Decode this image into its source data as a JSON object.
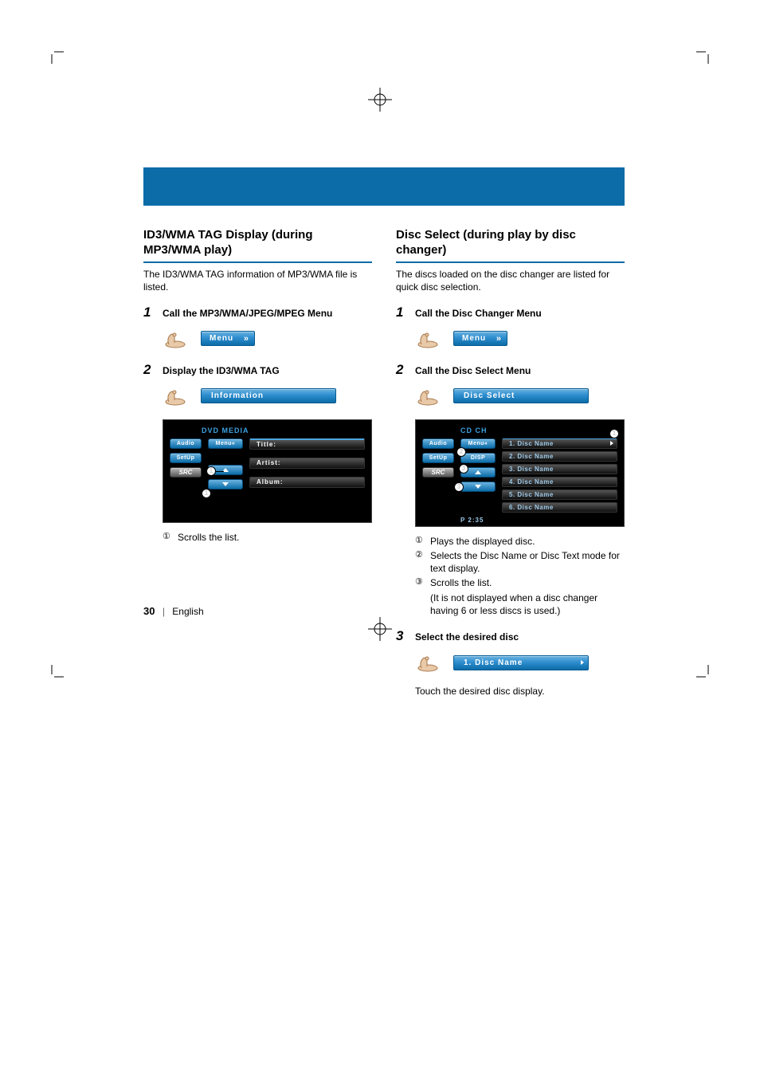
{
  "left": {
    "title": "ID3/WMA TAG Display (during MP3/WMA play)",
    "desc": "The ID3/WMA TAG information of MP3/WMA file is listed.",
    "step1": {
      "num": "1",
      "title": "Call the MP3/WMA/JPEG/MPEG Menu"
    },
    "menu_btn": "Menu",
    "step2": {
      "num": "2",
      "title": "Display the ID3/WMA TAG"
    },
    "info_btn": "Information",
    "panel": {
      "header": "DVD MEDIA",
      "side": {
        "audio": "Audio",
        "setup": "SetUp",
        "src": "SRC",
        "menu": "Menu«"
      },
      "rows": {
        "title": "Title:",
        "artist": "Artist:",
        "album": "Album:"
      }
    },
    "notes": {
      "n1": {
        "num": "1",
        "text": "Scrolls the list."
      }
    }
  },
  "right": {
    "title": "Disc Select (during play by disc changer)",
    "desc": "The discs loaded on the disc changer are listed for quick disc selection.",
    "step1": {
      "num": "1",
      "title": "Call the Disc Changer Menu"
    },
    "menu_btn": "Menu",
    "step2": {
      "num": "2",
      "title": "Call the Disc Select Menu"
    },
    "discselect_btn": "Disc Select",
    "panel": {
      "header": "CD CH",
      "side": {
        "audio": "Audio",
        "setup": "SetUp",
        "src": "SRC",
        "menu": "Menu«",
        "disp": "DISP"
      },
      "rows": {
        "d1": "1. Disc Name",
        "d2": "2. Disc Name",
        "d3": "3. Disc Name",
        "d4": "4. Disc Name",
        "d5": "5. Disc Name",
        "d6": "6. Disc Name"
      },
      "ptime": "P  2:35"
    },
    "notes": {
      "n1": {
        "num": "1",
        "text": "Plays the displayed disc."
      },
      "n2": {
        "num": "2",
        "text": "Selects the Disc Name or Disc Text mode for text display."
      },
      "n3": {
        "num": "3",
        "text": "Scrolls the list."
      },
      "n3b": "(It is not displayed when a disc changer having 6 or less discs is used.)"
    },
    "step3": {
      "num": "3",
      "title": "Select the desired disc"
    },
    "discname_btn": "1. Disc Name",
    "touch_text": "Touch the desired disc display."
  },
  "footer": {
    "page": "30",
    "lang": "English"
  }
}
